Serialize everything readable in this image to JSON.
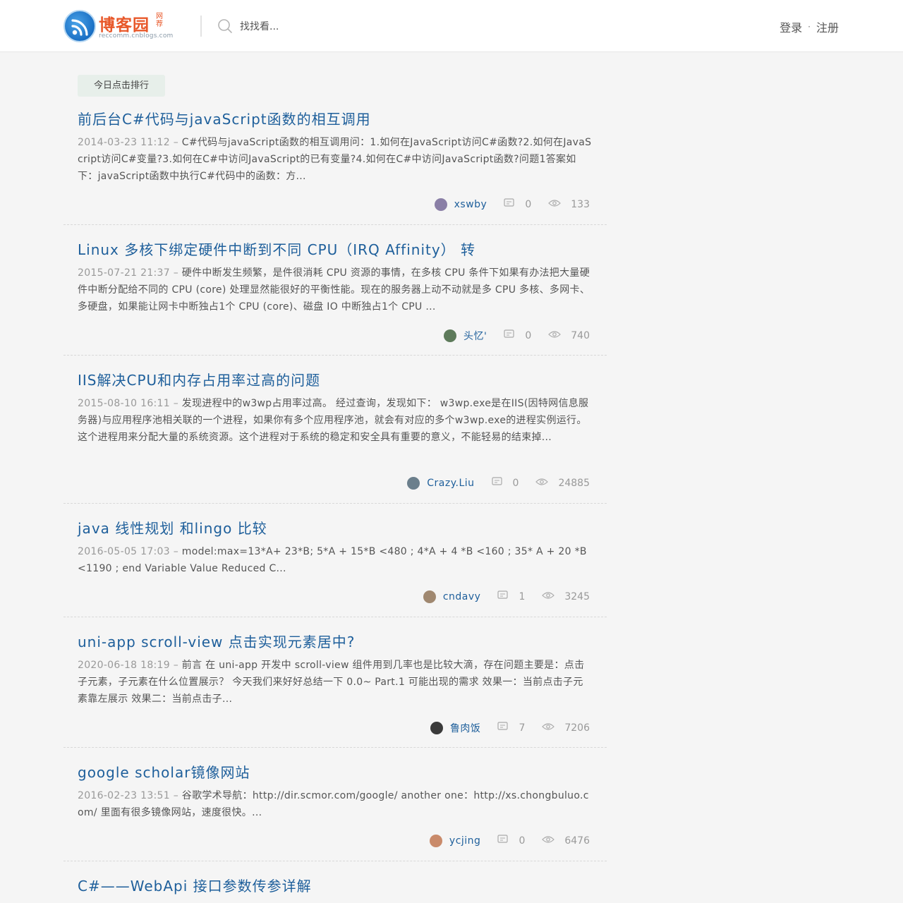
{
  "header": {
    "logo_name": "博客园",
    "logo_tag": "网荐",
    "logo_sub": "reccomm.cnblogs.com",
    "search_placeholder": "找找看...",
    "login_label": "登录",
    "separator": "·",
    "register_label": "注册"
  },
  "section_badge": "今日点击排行",
  "posts": [
    {
      "title": "前后台C#代码与javaScript函数的相互调用",
      "date": "2014-03-23 11:12",
      "summary": "C#代码与javaScript函数的相互调用问：1.如何在JavaScript访问C#函数?2.如何在JavaScript访问C#变量?3.如何在C#中访问JavaScript的已有变量?4.如何在C#中访问JavaScript函数?问题1答案如下：javaScript函数中执行C#代码中的函数：方...",
      "author": "xswby",
      "comments": "0",
      "views": "133",
      "avatar_color": "#8a7fa6"
    },
    {
      "title": "Linux 多核下绑定硬件中断到不同 CPU（IRQ Affinity） 转",
      "date": "2015-07-21 21:37",
      "summary": "硬件中断发生频繁，是件很消耗 CPU 资源的事情，在多核 CPU 条件下如果有办法把大量硬件中断分配给不同的 CPU (core) 处理显然能很好的平衡性能。现在的服务器上动不动就是多 CPU 多核、多网卡、多硬盘，如果能让网卡中断独占1个 CPU (core)、磁盘 IO 中断独占1个 CPU ...",
      "author": "头忆'",
      "comments": "0",
      "views": "740",
      "avatar_color": "#5d7a5a"
    },
    {
      "title": "IIS解决CPU和内存占用率过高的问题",
      "date": "2015-08-10 16:11",
      "summary": "发现进程中的w3wp占用率过高。 经过查询，发现如下： w3wp.exe是在IIS(因特网信息服务器)与应用程序池相关联的一个进程，如果你有多个应用程序池，就会有对应的多个w3wp.exe的进程实例运行。这个进程用来分配大量的系统资源。这个进程对于系统的稳定和安全具有重要的意义，不能轻易的结束掉...",
      "author": "Crazy.Liu",
      "comments": "0",
      "views": "24885",
      "avatar_color": "#6b7f8c"
    },
    {
      "title": "java 线性规划 和lingo 比较",
      "date": "2016-05-05 17:03",
      "summary": " model:max=13*A+ 23*B; 5*A + 15*B <480 ; 4*A + 4 *B <160 ; 35* A + 20 *B <1190 ; end Variable Value Reduced C...",
      "author": "cndavy",
      "comments": "1",
      "views": "3245",
      "avatar_color": "#a08870"
    },
    {
      "title": "uni-app scroll-view 点击实现元素居中?",
      "date": "2020-06-18 18:19",
      "summary": "前言 在 uni-app 开发中 scroll-view 组件用到几率也是比较大滴，存在问题主要是：点击子元素，子元素在什么位置展示？ 今天我们来好好总结一下 0.0~ Part.1 可能出现的需求 效果一：当前点击子元素靠左展示  效果二：当前点击子...",
      "author": "鲁肉饭",
      "comments": "7",
      "views": "7206",
      "avatar_color": "#3a3a3a"
    },
    {
      "title": "google scholar镜像网站",
      "date": "2016-02-23 13:51",
      "summary": "谷歌学术导航：http://dir.scmor.com/google/ another one：http://xs.chongbuluo.com/ 里面有很多镜像网站，速度很快。...",
      "author": "ycjing",
      "comments": "0",
      "views": "6476",
      "avatar_color": "#c98a6a"
    },
    {
      "title": "C#——WebApi 接口参数传参详解",
      "date": "",
      "summary": "",
      "author": "",
      "comments": "",
      "views": "",
      "avatar_color": "#999999"
    }
  ]
}
